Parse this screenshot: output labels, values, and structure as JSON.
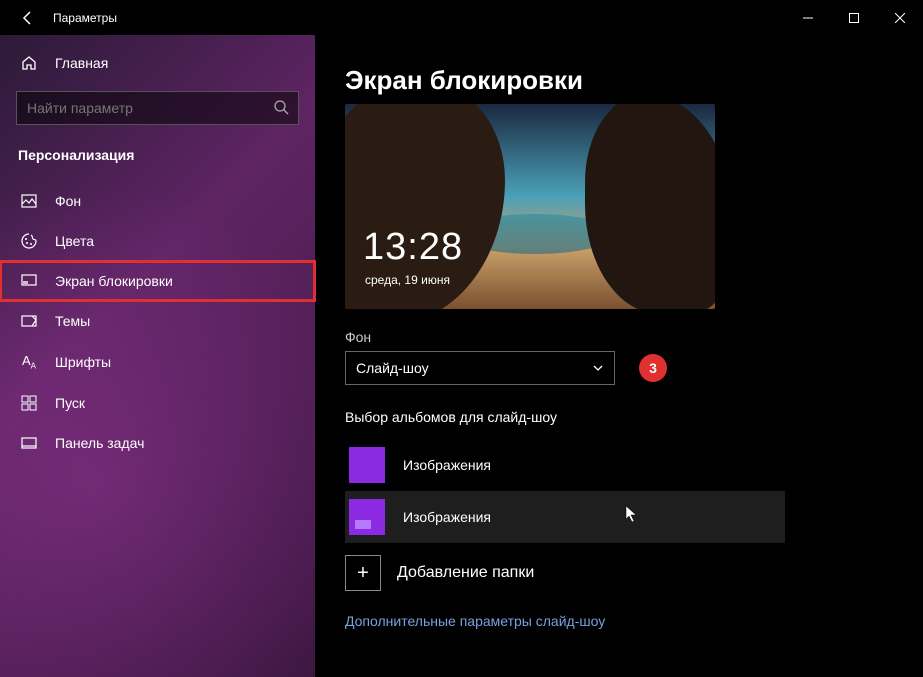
{
  "titlebar": {
    "title": "Параметры"
  },
  "sidebar": {
    "home": "Главная",
    "searchPlaceholder": "Найти параметр",
    "category": "Персонализация",
    "items": [
      {
        "label": "Фон"
      },
      {
        "label": "Цвета"
      },
      {
        "label": "Экран блокировки"
      },
      {
        "label": "Темы"
      },
      {
        "label": "Шрифты"
      },
      {
        "label": "Пуск"
      },
      {
        "label": "Панель задач"
      }
    ]
  },
  "main": {
    "title": "Экран блокировки",
    "preview": {
      "time": "13:28",
      "date": "среда, 19 июня"
    },
    "backgroundLabel": "Фон",
    "backgroundValue": "Слайд-шоу",
    "badge": "3",
    "albumsLabel": "Выбор альбомов для слайд-шоу",
    "albums": [
      {
        "label": "Изображения"
      },
      {
        "label": "Изображения"
      }
    ],
    "addFolder": "Добавление папки",
    "moreLink": "Дополнительные параметры слайд-шоу"
  }
}
